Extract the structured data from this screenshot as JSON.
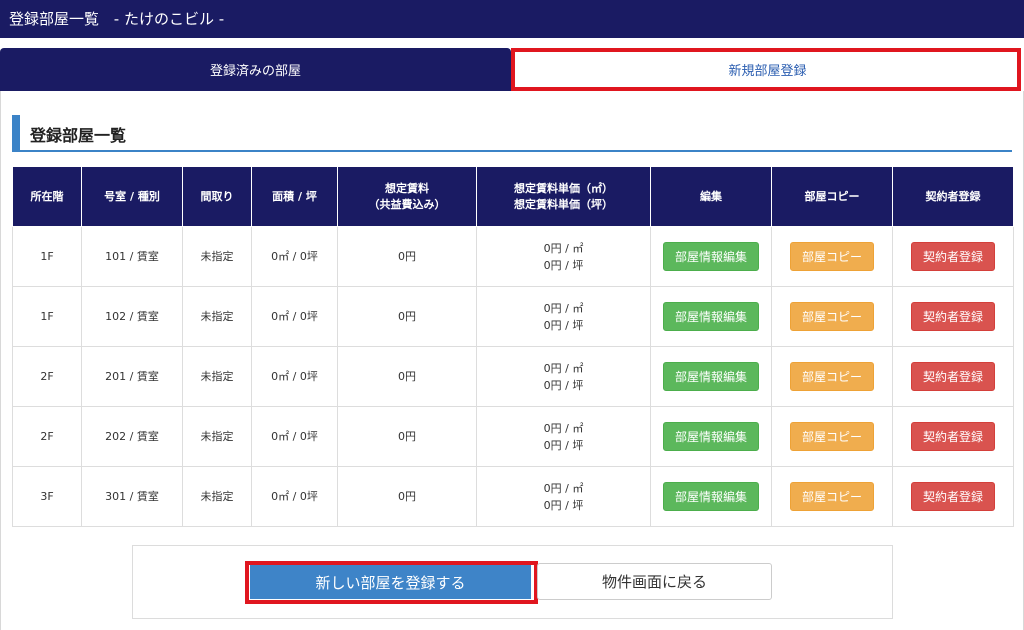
{
  "header": {
    "title": "登録部屋一覧",
    "building": "- たけのこビル -"
  },
  "tabs": {
    "registered": "登録済みの部屋",
    "new": "新規部屋登録"
  },
  "section": {
    "title": "登録部屋一覧"
  },
  "table": {
    "headers": {
      "floor": "所在階",
      "room": "号室 / 種別",
      "layout": "間取り",
      "area": "面積 / 坪",
      "rent_line1": "想定賃料",
      "rent_line2": "（共益費込み）",
      "unit_line1": "想定賃料単価（㎡）",
      "unit_line2": "想定賃料単価（坪）",
      "edit": "編集",
      "copy": "部屋コピー",
      "contract": "契約者登録"
    },
    "rows": [
      {
        "floor": "1F",
        "room": "101 / 賃室",
        "layout": "未指定",
        "area": "0㎡ / 0坪",
        "rent": "0円",
        "unit_sqm": "0円 / ㎡",
        "unit_tsubo": "0円 / 坪",
        "edit": "部屋情報編集",
        "copy": "部屋コピー",
        "contract": "契約者登録"
      },
      {
        "floor": "1F",
        "room": "102 / 賃室",
        "layout": "未指定",
        "area": "0㎡ / 0坪",
        "rent": "0円",
        "unit_sqm": "0円 / ㎡",
        "unit_tsubo": "0円 / 坪",
        "edit": "部屋情報編集",
        "copy": "部屋コピー",
        "contract": "契約者登録"
      },
      {
        "floor": "2F",
        "room": "201 / 賃室",
        "layout": "未指定",
        "area": "0㎡ / 0坪",
        "rent": "0円",
        "unit_sqm": "0円 / ㎡",
        "unit_tsubo": "0円 / 坪",
        "edit": "部屋情報編集",
        "copy": "部屋コピー",
        "contract": "契約者登録"
      },
      {
        "floor": "2F",
        "room": "202 / 賃室",
        "layout": "未指定",
        "area": "0㎡ / 0坪",
        "rent": "0円",
        "unit_sqm": "0円 / ㎡",
        "unit_tsubo": "0円 / 坪",
        "edit": "部屋情報編集",
        "copy": "部屋コピー",
        "contract": "契約者登録"
      },
      {
        "floor": "3F",
        "room": "301 / 賃室",
        "layout": "未指定",
        "area": "0㎡ / 0坪",
        "rent": "0円",
        "unit_sqm": "0円 / ㎡",
        "unit_tsubo": "0円 / 坪",
        "edit": "部屋情報編集",
        "copy": "部屋コピー",
        "contract": "契約者登録"
      }
    ]
  },
  "actions": {
    "new_room": "新しい部屋を登録する",
    "back": "物件画面に戻る"
  },
  "colors": {
    "navy": "#1a1b63",
    "accent_blue": "#3e84c8",
    "highlight_red": "#e0161f",
    "edit_green": "#5cb85c",
    "copy_orange": "#f0ad4e",
    "contract_red": "#d9534f"
  }
}
